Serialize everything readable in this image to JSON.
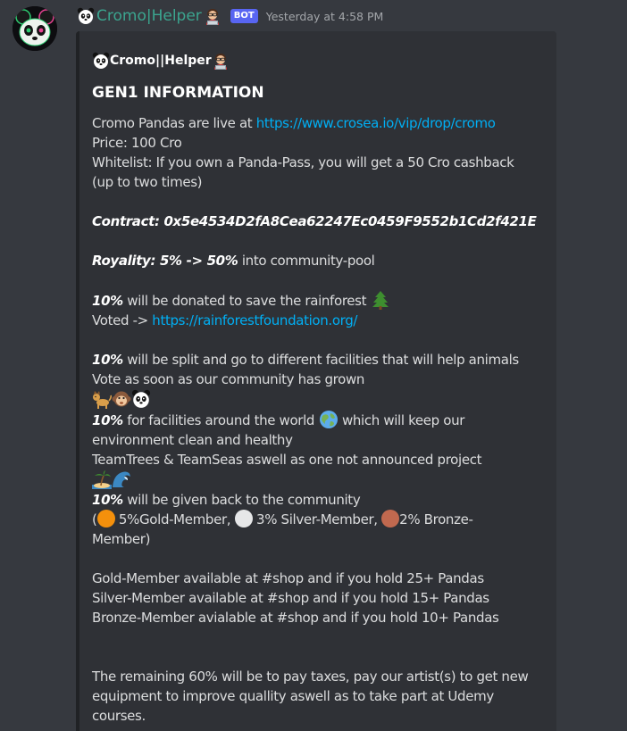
{
  "author": {
    "name": "Cromo|Helper",
    "bot_tag": "BOT",
    "timestamp": "Yesterday at 4:58 PM",
    "name_color": "#3ba58f"
  },
  "embed": {
    "author_name": "Cromo||Helper",
    "title": "GEN1 INFORMATION",
    "lines": {
      "l1_text": "Cromo Pandas are live at ",
      "l1_link": "https://www.crosea.io/vip/drop/cromo",
      "price": "Price: 100 Cro",
      "whitelist": "Whitelist: If you own a Panda-Pass, you will get a 50 Cro cashback",
      "whitelist2": "(up to two times)",
      "contract": "Contract: 0x5e4534D2fA8Cea62247Ec0459F9552b1Cd2f421E",
      "royality_bold": "Royality: 5% -> 50%",
      "royality_rest": " into community-pool",
      "rain_bold": "10%",
      "rain_rest": " will be donated to save the rainforest ",
      "voted_text": "Voted -> ",
      "voted_link": "https://rainforestfoundation.org/",
      "animals_bold": "10%",
      "animals_rest": " will be split and go to different facilities that will help animals",
      "animals2": "Vote as soon as our community has grown",
      "world_bold": "10%",
      "world_rest1": " for facilities around the world ",
      "world_rest2": " which will keep our",
      "world2": "environment clean and healthy",
      "teams": "TeamTrees & TeamSeas aswell as one not announced project",
      "back_bold": "10%",
      "back_rest": " will be given back to the community",
      "members_open": "(",
      "members_gold": " 5%Gold-Member, ",
      "members_silver": " 3% Silver-Member, ",
      "members_bronze": "2% Bronze-",
      "members2": "Member)",
      "gold": "Gold-Member available at #shop and if you hold 25+ Pandas",
      "silver": "Silver-Member available at #shop and if you hold 15+ Pandas",
      "bronze": "Bronze-Member avialable at #shop and if you hold 10+ Pandas",
      "remaining1": "The remaining 60% will be to pay taxes, pay our artist(s) to get new",
      "remaining2": "equipment to improve quallity aswell as to take part at Udemy",
      "remaining3": "courses."
    }
  },
  "colors": {
    "background": "#36393f",
    "embed_bg": "#2f3136",
    "link": "#00aff4",
    "gold": "#f4900c",
    "silver": "#e6e7e8",
    "bronze": "#c1694f"
  },
  "icons": [
    "panda-icon",
    "technologist-icon",
    "evergreen-tree-icon",
    "dog-icon",
    "monkey-icon",
    "earth-globe-icon",
    "island-icon",
    "wave-icon",
    "orange-circle-icon",
    "white-circle-icon",
    "brown-circle-icon"
  ]
}
